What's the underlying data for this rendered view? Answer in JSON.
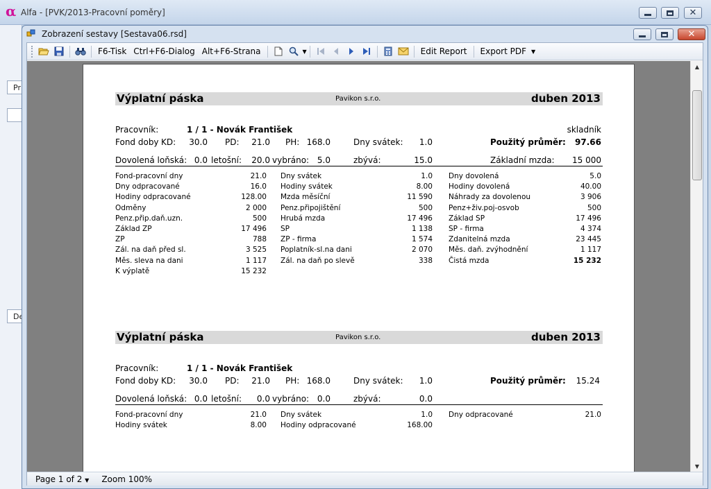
{
  "app": {
    "title": "Alfa - [PVK/2013-Pracovní poměry]",
    "left_labels": [
      "Pr",
      "De"
    ]
  },
  "report_window": {
    "title": "Zobrazení sestavy [Sestava06.rsd]"
  },
  "toolbar": {
    "print_label": "F6-Tisk",
    "dialog_label": "Ctrl+F6-Dialog",
    "page_label": "Alt+F6-Strana",
    "edit_report_label": "Edit Report",
    "export_label": "Export PDF"
  },
  "status": {
    "page": "Page 1 of 2",
    "zoom": "Zoom 100%"
  },
  "labels": {
    "title": "Výplatní páska",
    "company": "Pavikon s.r.o.",
    "period": "duben 2013",
    "worker": "Pracovník:",
    "fund": "Fond doby",
    "kd": "KD:",
    "pd": "PD:",
    "ph": "PH:",
    "holiday_days": "Dny svátek:",
    "avg": "Použitý průměr:",
    "vac_last": "Dovolená loňská:",
    "vac_this": "letošní:",
    "vac_taken": "vybráno:",
    "vac_left": "zbývá:",
    "base_salary": "Základní mzda:"
  },
  "slips": [
    {
      "worker": "1 / 1 - Novák František",
      "position": "skladník",
      "kd": "30.0",
      "pd": "21.0",
      "ph": "168.0",
      "holiday_days": "1.0",
      "avg": "97.66",
      "vac_last": "0.0",
      "vac_this": "20.0",
      "vac_taken": "5.0",
      "vac_left": "15.0",
      "base_salary": "15 000",
      "columns": [
        [
          {
            "label": "Fond-pracovní dny",
            "value": "21.0"
          },
          {
            "label": "Dny odpracované",
            "value": "16.0"
          },
          {
            "label": "Hodiny odpracované",
            "value": "128.00"
          },
          {
            "label": "Odměny",
            "value": "2 000"
          },
          {
            "label": "Penz.přip.daň.uzn.",
            "value": "500"
          },
          {
            "label": "Základ ZP",
            "value": "17 496"
          },
          {
            "label": "ZP",
            "value": "788"
          },
          {
            "label": "Zál. na daň před sl.",
            "value": "3 525"
          },
          {
            "label": "Měs. sleva na dani",
            "value": "1 117"
          },
          {
            "label": "K výplatě",
            "value": "15 232"
          }
        ],
        [
          {
            "label": "Dny svátek",
            "value": "1.0"
          },
          {
            "label": "Hodiny svátek",
            "value": "8.00"
          },
          {
            "label": "Mzda měsíční",
            "value": "11 590"
          },
          {
            "label": "Penz.připojištění",
            "value": "500"
          },
          {
            "label": "Hrubá mzda",
            "value": "17 496"
          },
          {
            "label": "SP",
            "value": "1 138"
          },
          {
            "label": "ZP - firma",
            "value": "1 574"
          },
          {
            "label": "Poplatník-sl.na dani",
            "value": "2 070"
          },
          {
            "label": "Zál. na daň po slevě",
            "value": "338"
          }
        ],
        [
          {
            "label": "Dny dovolená",
            "value": "5.0"
          },
          {
            "label": "Hodiny dovolená",
            "value": "40.00"
          },
          {
            "label": "Náhrady za dovolenou",
            "value": "3 906"
          },
          {
            "label": "Penz+živ.poj-osvob",
            "value": "500"
          },
          {
            "label": "Základ SP",
            "value": "17 496"
          },
          {
            "label": "SP - firma",
            "value": "4 374"
          },
          {
            "label": "Zdanitelná mzda",
            "value": "23 445"
          },
          {
            "label": "Měs. daň. zvýhodnění",
            "value": "1 117"
          },
          {
            "label": "Čistá mzda",
            "value": "15 232",
            "bold": true
          }
        ]
      ]
    },
    {
      "worker": "1 / 1 - Novák František",
      "kd": "30.0",
      "pd": "21.0",
      "ph": "168.0",
      "holiday_days": "1.0",
      "avg": "15.24",
      "vac_last": "0.0",
      "vac_this": "0.0",
      "vac_taken": "0.0",
      "vac_left": "0.0",
      "columns": [
        [
          {
            "label": "Fond-pracovní dny",
            "value": "21.0"
          },
          {
            "label": "Hodiny svátek",
            "value": "8.00"
          }
        ],
        [
          {
            "label": "Dny svátek",
            "value": "1.0"
          },
          {
            "label": "Hodiny odpracované",
            "value": "168.00"
          }
        ],
        [
          {
            "label": "Dny odpracované",
            "value": "21.0"
          }
        ]
      ]
    }
  ]
}
